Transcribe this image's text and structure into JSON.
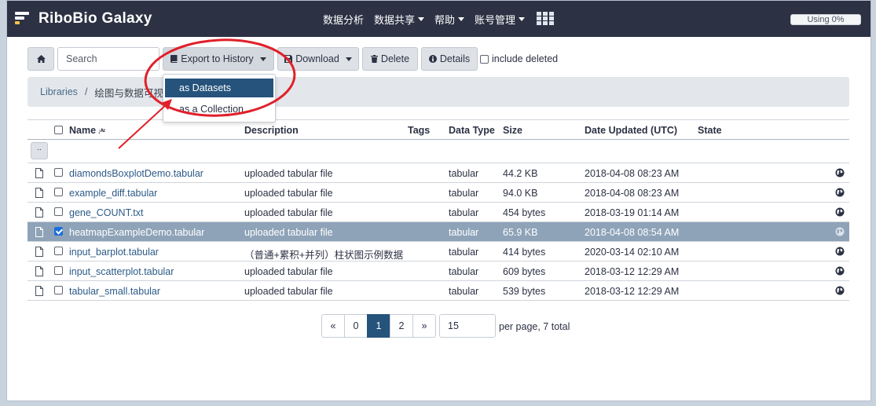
{
  "masthead": {
    "brand": "RiboBio Galaxy",
    "nav": [
      {
        "label": "数据分析",
        "dropdown": false
      },
      {
        "label": "数据共享",
        "dropdown": true
      },
      {
        "label": "帮助",
        "dropdown": true
      },
      {
        "label": "账号管理",
        "dropdown": true
      }
    ],
    "quota": "Using 0%"
  },
  "toolbar": {
    "home_icon": "home-icon",
    "search_placeholder": "Search",
    "export_label": "Export to History",
    "download_label": "Download",
    "delete_label": "Delete",
    "details_label": "Details",
    "include_deleted_label": "include deleted"
  },
  "dropdown": {
    "items": [
      "as Datasets",
      "as a Collection"
    ],
    "active": "as Datasets"
  },
  "breadcrumb": {
    "root": "Libraries",
    "separator": "/",
    "current": "绘图与数据可视化"
  },
  "table": {
    "headers": {
      "name": "Name",
      "description": "Description",
      "tags": "Tags",
      "data_type": "Data Type",
      "size": "Size",
      "date_updated": "Date Updated (UTC)",
      "state": "State"
    },
    "up_label": "..",
    "rows": [
      {
        "name": "diamondsBoxplotDemo.tabular",
        "description": "uploaded tabular file",
        "data_type": "tabular",
        "size": "44.2 KB",
        "date": "2018-04-08 08:23 AM",
        "selected": false
      },
      {
        "name": "example_diff.tabular",
        "description": "uploaded tabular file",
        "data_type": "tabular",
        "size": "94.0 KB",
        "date": "2018-04-08 08:23 AM",
        "selected": false
      },
      {
        "name": "gene_COUNT.txt",
        "description": "uploaded tabular file",
        "data_type": "tabular",
        "size": "454 bytes",
        "date": "2018-03-19 01:14 AM",
        "selected": false
      },
      {
        "name": "heatmapExampleDemo.tabular",
        "description": "uploaded tabular file",
        "data_type": "tabular",
        "size": "65.9 KB",
        "date": "2018-04-08 08:54 AM",
        "selected": true
      },
      {
        "name": "input_barplot.tabular",
        "description": "（普通+累积+并列）柱状图示例数据",
        "data_type": "tabular",
        "size": "414 bytes",
        "date": "2020-03-14 02:10 AM",
        "selected": false
      },
      {
        "name": "input_scatterplot.tabular",
        "description": "uploaded tabular file",
        "data_type": "tabular",
        "size": "609 bytes",
        "date": "2018-03-12 12:29 AM",
        "selected": false
      },
      {
        "name": "tabular_small.tabular",
        "description": "uploaded tabular file",
        "data_type": "tabular",
        "size": "539 bytes",
        "date": "2018-03-12 12:29 AM",
        "selected": false
      }
    ]
  },
  "pagination": {
    "prev": "«",
    "pages": [
      "0",
      "1",
      "2"
    ],
    "current": "1",
    "next": "»",
    "per_page": "15",
    "per_page_text": "per page, 7 total"
  },
  "annotation": {
    "color": "#e0202a"
  }
}
